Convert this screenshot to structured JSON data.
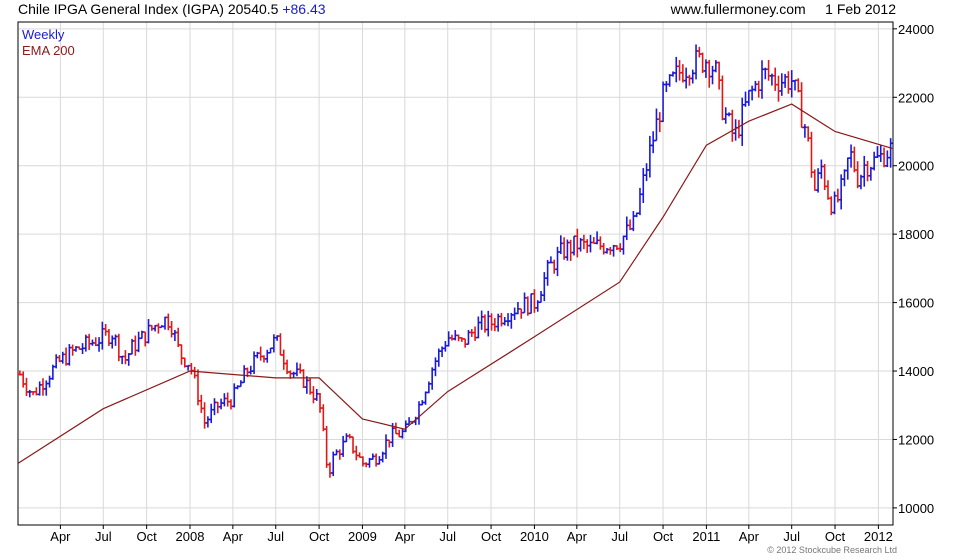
{
  "header": {
    "title": "Chile IPGA General Index (IGPA) 20540.5",
    "change": "+86.43",
    "site": "www.fullermoney.com",
    "date": "1 Feb 2012"
  },
  "legend": {
    "weekly": "Weekly",
    "ema": "EMA 200"
  },
  "copyright": "© 2012 Stockcube Research Ltd",
  "colors": {
    "up": "#1a1ad6",
    "down": "#e01818",
    "ema": "#8b1a1a",
    "grid": "#d9d9d9",
    "frame": "#000000"
  },
  "chart_data": {
    "type": "line",
    "title": "Chile IPGA General Index (IGPA)",
    "series": [
      {
        "name": "Weekly",
        "style": "OHLC bars (blue up / red down)"
      },
      {
        "name": "EMA 200"
      }
    ],
    "ylim": [
      9500,
      24200
    ],
    "y_ticks": [
      10000,
      12000,
      14000,
      16000,
      18000,
      20000,
      22000,
      24000
    ],
    "x_ticks": [
      "Apr",
      "Jul",
      "Oct",
      "2008",
      "Apr",
      "Jul",
      "Oct",
      "2009",
      "Apr",
      "Jul",
      "Oct",
      "2010",
      "Apr",
      "Jul",
      "Oct",
      "2011",
      "Apr",
      "Jul",
      "Oct",
      "2012"
    ],
    "x_range": [
      "2007-01-01",
      "2012-02-01"
    ],
    "grid": true,
    "price_points": [
      [
        "2007-01-05",
        13900
      ],
      [
        "2007-02-01",
        13300
      ],
      [
        "2007-03-01",
        13800
      ],
      [
        "2007-04-01",
        14300
      ],
      [
        "2007-05-01",
        14600
      ],
      [
        "2007-06-01",
        14800
      ],
      [
        "2007-07-01",
        15000
      ],
      [
        "2007-07-20",
        15100
      ],
      [
        "2007-08-15",
        14300
      ],
      [
        "2007-09-01",
        14700
      ],
      [
        "2007-10-01",
        15100
      ],
      [
        "2007-11-01",
        15500
      ],
      [
        "2007-11-20",
        15500
      ],
      [
        "2007-12-10",
        14500
      ],
      [
        "2008-01-01",
        14200
      ],
      [
        "2008-01-20",
        13200
      ],
      [
        "2008-02-01",
        12500
      ],
      [
        "2008-03-01",
        13000
      ],
      [
        "2008-04-01",
        13200
      ],
      [
        "2008-05-01",
        14000
      ],
      [
        "2008-06-01",
        14500
      ],
      [
        "2008-07-01",
        14900
      ],
      [
        "2008-08-01",
        14000
      ],
      [
        "2008-09-01",
        13700
      ],
      [
        "2008-10-01",
        13100
      ],
      [
        "2008-10-20",
        11000
      ],
      [
        "2008-11-01",
        11500
      ],
      [
        "2008-12-01",
        12000
      ],
      [
        "2009-01-01",
        11300
      ],
      [
        "2009-02-01",
        11500
      ],
      [
        "2009-03-01",
        12100
      ],
      [
        "2009-04-01",
        12200
      ],
      [
        "2009-05-01",
        13000
      ],
      [
        "2009-06-01",
        14200
      ],
      [
        "2009-07-01",
        15000
      ],
      [
        "2009-08-01",
        14800
      ],
      [
        "2009-09-01",
        15300
      ],
      [
        "2009-10-01",
        15400
      ],
      [
        "2009-11-01",
        15700
      ],
      [
        "2009-12-01",
        15900
      ],
      [
        "2010-01-01",
        16000
      ],
      [
        "2010-02-01",
        17000
      ],
      [
        "2010-03-01",
        17500
      ],
      [
        "2010-04-01",
        17700
      ],
      [
        "2010-05-01",
        17600
      ],
      [
        "2010-06-01",
        17700
      ],
      [
        "2010-07-01",
        17800
      ],
      [
        "2010-08-01",
        18300
      ],
      [
        "2010-09-01",
        20300
      ],
      [
        "2010-10-01",
        22000
      ],
      [
        "2010-11-01",
        22700
      ],
      [
        "2010-12-01",
        23000
      ],
      [
        "2011-01-01",
        23100
      ],
      [
        "2011-01-20",
        22800
      ],
      [
        "2011-02-01",
        21800
      ],
      [
        "2011-03-01",
        20800
      ],
      [
        "2011-04-01",
        22000
      ],
      [
        "2011-05-01",
        22700
      ],
      [
        "2011-06-01",
        22500
      ],
      [
        "2011-07-01",
        22500
      ],
      [
        "2011-08-01",
        21000
      ],
      [
        "2011-08-20",
        19200
      ],
      [
        "2011-09-01",
        20000
      ],
      [
        "2011-09-20",
        19000
      ],
      [
        "2011-10-01",
        18800
      ],
      [
        "2011-10-20",
        19500
      ],
      [
        "2011-11-01",
        20400
      ],
      [
        "2011-11-20",
        19600
      ],
      [
        "2011-12-01",
        20000
      ],
      [
        "2012-01-01",
        20200
      ],
      [
        "2012-02-01",
        20540
      ]
    ],
    "ema_points": [
      [
        "2007-01-01",
        11300
      ],
      [
        "2007-07-01",
        12900
      ],
      [
        "2008-01-01",
        14000
      ],
      [
        "2008-07-01",
        13800
      ],
      [
        "2008-10-01",
        13800
      ],
      [
        "2009-01-01",
        12600
      ],
      [
        "2009-04-01",
        12300
      ],
      [
        "2009-07-01",
        13400
      ],
      [
        "2010-01-01",
        15000
      ],
      [
        "2010-07-01",
        16600
      ],
      [
        "2010-10-01",
        18500
      ],
      [
        "2011-01-01",
        20600
      ],
      [
        "2011-04-01",
        21300
      ],
      [
        "2011-07-01",
        21800
      ],
      [
        "2011-10-01",
        21000
      ],
      [
        "2012-02-01",
        20500
      ]
    ]
  }
}
